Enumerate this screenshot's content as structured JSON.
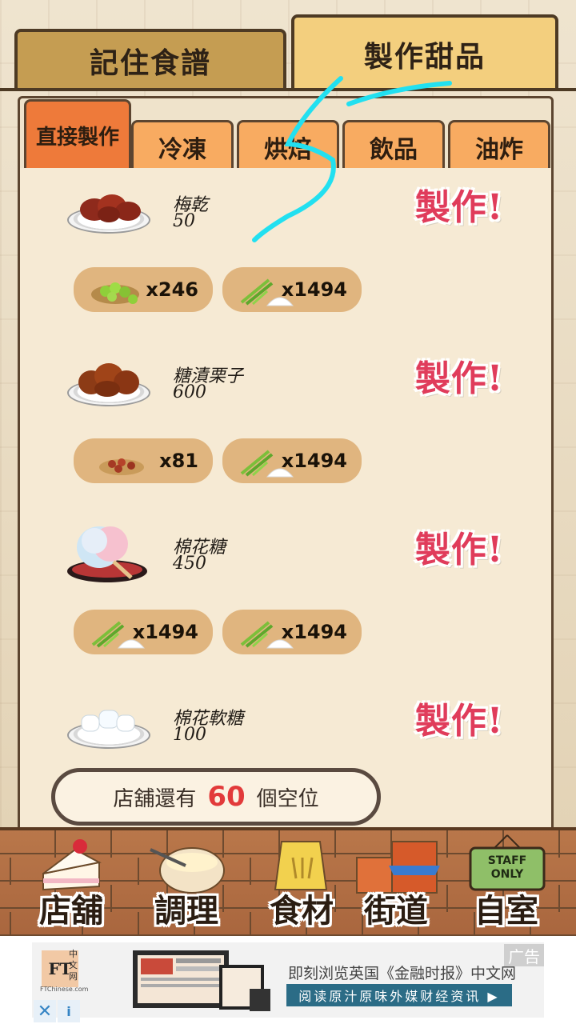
{
  "top_tabs": [
    {
      "label": "記住食譜",
      "active": false
    },
    {
      "label": "製作甜品",
      "active": true
    }
  ],
  "sub_tabs": [
    {
      "label": "直接製作",
      "active": true
    },
    {
      "label": "冷凍",
      "active": false
    },
    {
      "label": "烘焙",
      "active": false
    },
    {
      "label": "飲品",
      "active": false
    },
    {
      "label": "油炸",
      "active": false
    }
  ],
  "recipes": [
    {
      "name": "梅乾",
      "price": "50",
      "make_label": "製作!",
      "ingredients": [
        {
          "icon": "green-plum-icon",
          "count": "x246"
        },
        {
          "icon": "sugarcane-sugar-icon",
          "count": "x1494"
        }
      ]
    },
    {
      "name": "糖漬栗子",
      "price": "600",
      "make_label": "製作!",
      "ingredients": [
        {
          "icon": "chestnut-icon",
          "count": "x81"
        },
        {
          "icon": "sugarcane-sugar-icon",
          "count": "x1494"
        }
      ]
    },
    {
      "name": "棉花糖",
      "price": "450",
      "make_label": "製作!",
      "ingredients": [
        {
          "icon": "sugarcane-sugar-icon",
          "count": "x1494"
        },
        {
          "icon": "sugarcane-sugar-icon",
          "count": "x1494"
        }
      ]
    },
    {
      "name": "棉花軟糖",
      "price": "100",
      "make_label": "製作!",
      "ingredients": []
    }
  ],
  "shop_status": {
    "prefix": "店舖還有",
    "count": "60",
    "suffix": "個空位"
  },
  "nav": [
    {
      "label": "店舖",
      "icon": "cake-slice-icon"
    },
    {
      "label": "調理",
      "icon": "mixing-bowl-icon"
    },
    {
      "label": "食材",
      "icon": "flour-sack-icon"
    },
    {
      "label": "街道",
      "icon": "shop-building-icon"
    },
    {
      "label": "自室",
      "icon": "staff-only-sign-icon"
    }
  ],
  "staff_sign": "STAFF ONLY",
  "ad": {
    "logo": "FT",
    "logo_side": "中文网",
    "logo_url": "FTChinese.com",
    "title": "即刻浏览英国《金融时报》中文网",
    "cta": "阅读原汁原味外媒财经资讯 ▶",
    "badge": "广告",
    "close": "✕",
    "info": "i"
  },
  "colors": {
    "make_button": "#e03c5b",
    "active_subtab": "#ee7a3a",
    "subtab": "#f8ab61",
    "ingredient_pill": "#e0b57f",
    "count_highlight": "#e23a3a",
    "scribble": "#22e0f0"
  }
}
